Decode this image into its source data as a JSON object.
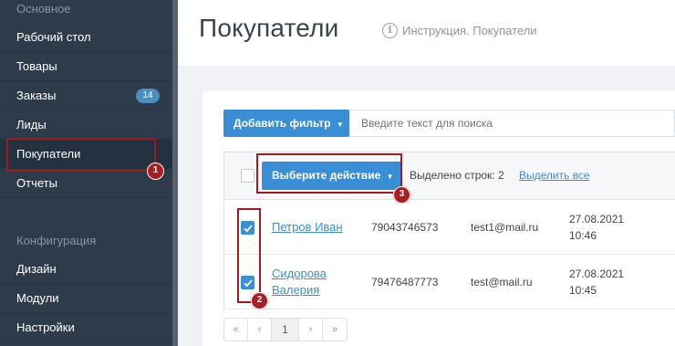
{
  "sidebar": {
    "section_main": "Основное",
    "items": [
      {
        "label": "Рабочий стол"
      },
      {
        "label": "Товары"
      },
      {
        "label": "Заказы",
        "badge": "14"
      },
      {
        "label": "Лиды"
      },
      {
        "label": "Покупатели"
      },
      {
        "label": "Отчеты"
      }
    ],
    "section_config": "Конфигурация",
    "config_items": [
      {
        "label": "Дизайн"
      },
      {
        "label": "Модули"
      },
      {
        "label": "Настройки"
      }
    ]
  },
  "header": {
    "title": "Покупатели",
    "help_icon": "info-circle-icon",
    "help_label": "Инструкция. Покупатели"
  },
  "toolbar": {
    "filter_button": "Добавить фильтр",
    "search_placeholder": "Введите текст для поиска"
  },
  "table": {
    "action_button": "Выберите действие",
    "selected_label": "Выделено строк: 2",
    "select_all": "Выделить все",
    "rows": [
      {
        "checked": true,
        "name_line1": "Петров Иван",
        "name_line2": "",
        "phone": "79043746573",
        "email": "test1@mail.ru",
        "date": "27.08.2021",
        "time": "10:46"
      },
      {
        "checked": true,
        "name_line1": "Сидорова",
        "name_line2": "Валерия",
        "phone": "79476487773",
        "email": "test@mail.ru",
        "date": "27.08.2021",
        "time": "10:45"
      }
    ]
  },
  "pagination": {
    "first": "«",
    "prev": "‹",
    "current": "1",
    "next": "›",
    "last": "»"
  },
  "annotations": [
    "1",
    "2",
    "3"
  ],
  "colors": {
    "sidebar_bg": "#2d3b4a",
    "accent": "#3a8ed6",
    "annotation": "#a81e22"
  }
}
